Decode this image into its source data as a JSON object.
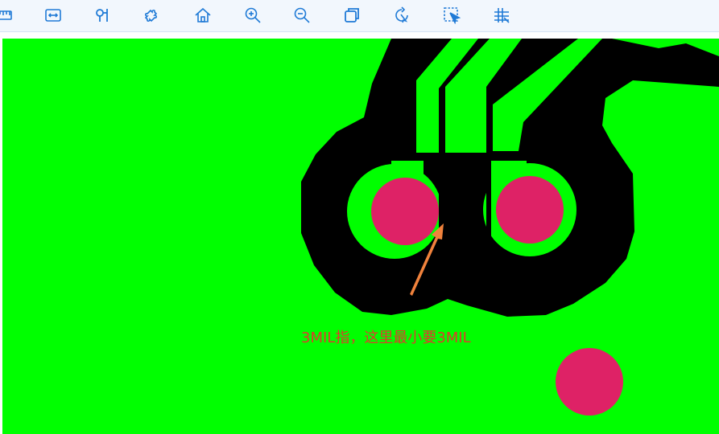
{
  "toolbar": {
    "icons": [
      "ruler-icon",
      "measure-icon",
      "probe-icon",
      "puzzle-icon",
      "home-icon",
      "zoom-in-icon",
      "zoom-out-icon",
      "layers-icon",
      "refresh-select-icon",
      "select-area-icon",
      "grid-icon"
    ]
  },
  "colors": {
    "board": "#00ff00",
    "clearance": "#000000",
    "pad": "#de2266",
    "arrow": "#f0823c",
    "annotation": "#e03a2c",
    "icon": "#1f7ad6"
  },
  "annotation": {
    "text": "3MIL指，这里最小要3MIL"
  }
}
